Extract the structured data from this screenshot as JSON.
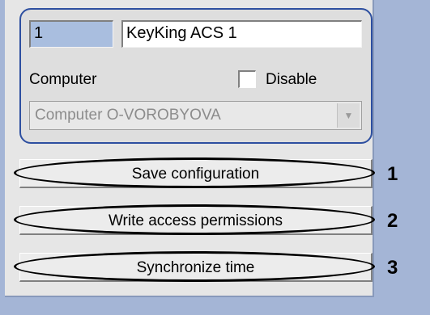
{
  "form": {
    "id_value": "1",
    "name_value": "KeyKing ACS 1",
    "computer_label": "Computer",
    "disable_label": "Disable",
    "disable_checked": false,
    "computer_selected": "Computer O-VOROBYOVA"
  },
  "buttons": {
    "save_label": "Save configuration",
    "write_label": "Write access permissions",
    "sync_label": "Synchronize time"
  },
  "callouts": {
    "one": "1",
    "two": "2",
    "three": "3"
  },
  "icons": {
    "dropdown": "chevron-down-icon"
  },
  "colors": {
    "background": "#a4b5d6",
    "panel": "#e6e6e6",
    "group_border": "#2d4fa0",
    "highlight_oval": "#000000"
  }
}
